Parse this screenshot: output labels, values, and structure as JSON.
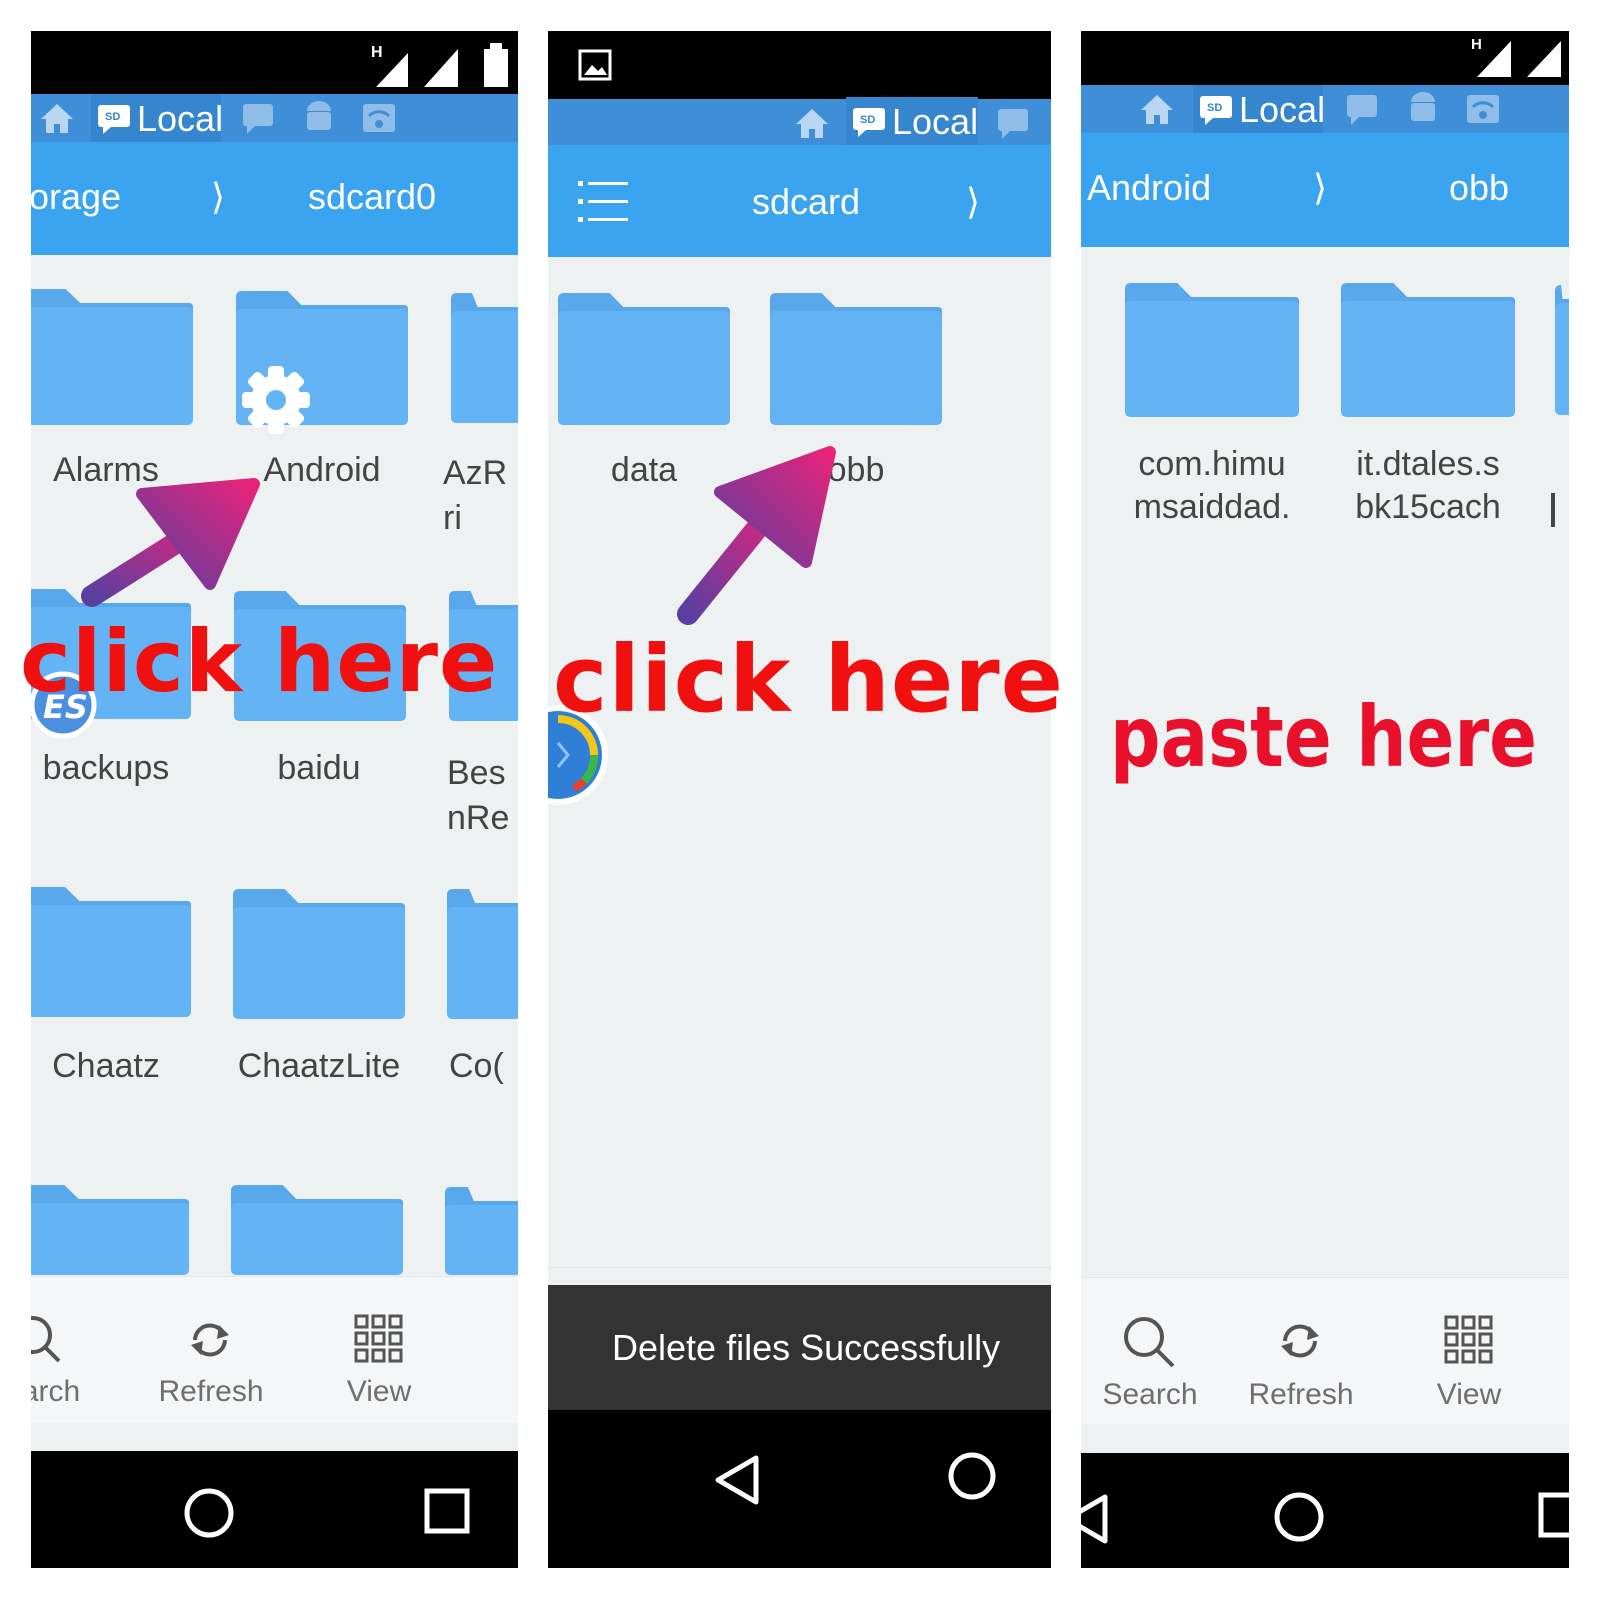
{
  "colors": {
    "accent": "#3aa4f0",
    "tabs": "#3f8fd8",
    "folder": "#64b4f5",
    "callout": "#f01010"
  },
  "panel1": {
    "tab_local": "Local",
    "path_left": "orage",
    "path_sep": "⟩",
    "path_current": "sdcard0",
    "folders": [
      "Alarms",
      "Android",
      "AzR\nri",
      "backups",
      "baidu",
      "Bes\nnRe",
      "Chaatz",
      "ChaatzLite",
      "Co("
    ],
    "callout": "click here",
    "toolbar": {
      "search": "arch",
      "refresh": "Refresh",
      "view": "View"
    }
  },
  "panel2": {
    "tab_local": "Local",
    "path_current": "sdcard",
    "path_sep": "⟩",
    "folders": [
      "data",
      "obb"
    ],
    "callout": "click here",
    "toast": "Delete files Successfully"
  },
  "panel3": {
    "tab_local": "Local",
    "path_left": "Android",
    "path_sep": "⟩",
    "path_current": "obb",
    "folders": [
      "com.himu\nmsaiddad.",
      "it.dtales.s\nbk15cach"
    ],
    "callout": "paste here",
    "toolbar": {
      "search": "Search",
      "refresh": "Refresh",
      "view": "View"
    }
  }
}
